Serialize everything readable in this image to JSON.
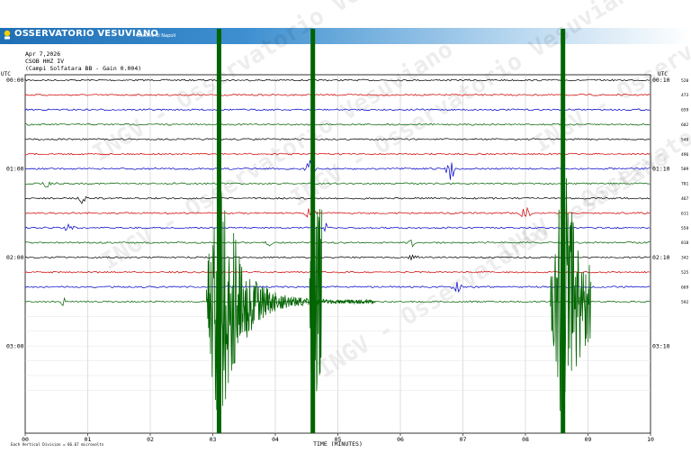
{
  "header": {
    "brand": "OSSERVATORIO VESUVIANO",
    "subtitle": "Sezione di Napoli",
    "logo_text": "INGV"
  },
  "info": {
    "date": "Apr 7,2026",
    "station": "CSOB HHZ IV",
    "location": "(Campi Solfatara BB - Gain 0.004)"
  },
  "utc_label": "UTC",
  "footer_note": "Each Vertical Division = 66.67 microvolts",
  "watermark": "INGV - Osservatorio Vesuviano",
  "colors": {
    "black": "#000000",
    "red": "#d40000",
    "blue": "#0000cc",
    "green": "#006400",
    "grid": "#c8c8c8"
  },
  "chart_data": {
    "type": "line",
    "xlabel": "TIME (MINUTES)",
    "x_ticks": [
      "00",
      "01",
      "02",
      "03",
      "04",
      "05",
      "06",
      "07",
      "08",
      "09",
      "10"
    ],
    "xlim": [
      0,
      10
    ],
    "left_time_labels": [
      {
        "row": 0,
        "label": "00:00"
      },
      {
        "row": 6,
        "label": "01:00"
      },
      {
        "row": 12,
        "label": "02:00"
      },
      {
        "row": 18,
        "label": "03:00"
      }
    ],
    "right_time_labels": [
      {
        "row": 0,
        "label": "00:10"
      },
      {
        "row": 6,
        "label": "01:10"
      },
      {
        "row": 12,
        "label": "02:10"
      },
      {
        "row": 18,
        "label": "03:10"
      }
    ],
    "trace_colors": [
      "black",
      "red",
      "blue",
      "green"
    ],
    "rows_with_trace": 16,
    "total_rows": 22,
    "amplitudes": [
      "520",
      "473",
      "659",
      "602",
      "540",
      "496",
      "509",
      "781",
      "467",
      "611",
      "559",
      "818",
      "342",
      "525",
      "669",
      "592"
    ],
    "events": [
      {
        "row": 6,
        "minute": 4.55,
        "amp": 12
      },
      {
        "row": 6,
        "minute": 6.8,
        "amp": 14
      },
      {
        "row": 7,
        "minute": 0.35,
        "amp": 5
      },
      {
        "row": 8,
        "minute": 0.9,
        "amp": 6
      },
      {
        "row": 9,
        "minute": 4.55,
        "amp": 9
      },
      {
        "row": 9,
        "minute": 8.0,
        "amp": 8
      },
      {
        "row": 10,
        "minute": 0.7,
        "amp": 7
      },
      {
        "row": 10,
        "minute": 4.8,
        "amp": 6
      },
      {
        "row": 11,
        "minute": 3.9,
        "amp": 4
      },
      {
        "row": 11,
        "minute": 6.2,
        "amp": 5
      },
      {
        "row": 12,
        "minute": 6.2,
        "amp": 5
      },
      {
        "row": 14,
        "minute": 6.9,
        "amp": 8
      },
      {
        "row": 15,
        "minute": 0.6,
        "amp": 6
      }
    ],
    "saturated_events": [
      {
        "start_row": 15,
        "start_minute": 2.9,
        "peak_minute": 3.1,
        "end_minute": 5.6
      },
      {
        "start_row": 15,
        "start_minute": 8.4,
        "peak_minute": 8.6,
        "end_minute": 9.05
      },
      {
        "start_row": 15,
        "start_minute": 4.55,
        "peak_minute": 4.6,
        "end_minute": 4.75
      }
    ]
  }
}
